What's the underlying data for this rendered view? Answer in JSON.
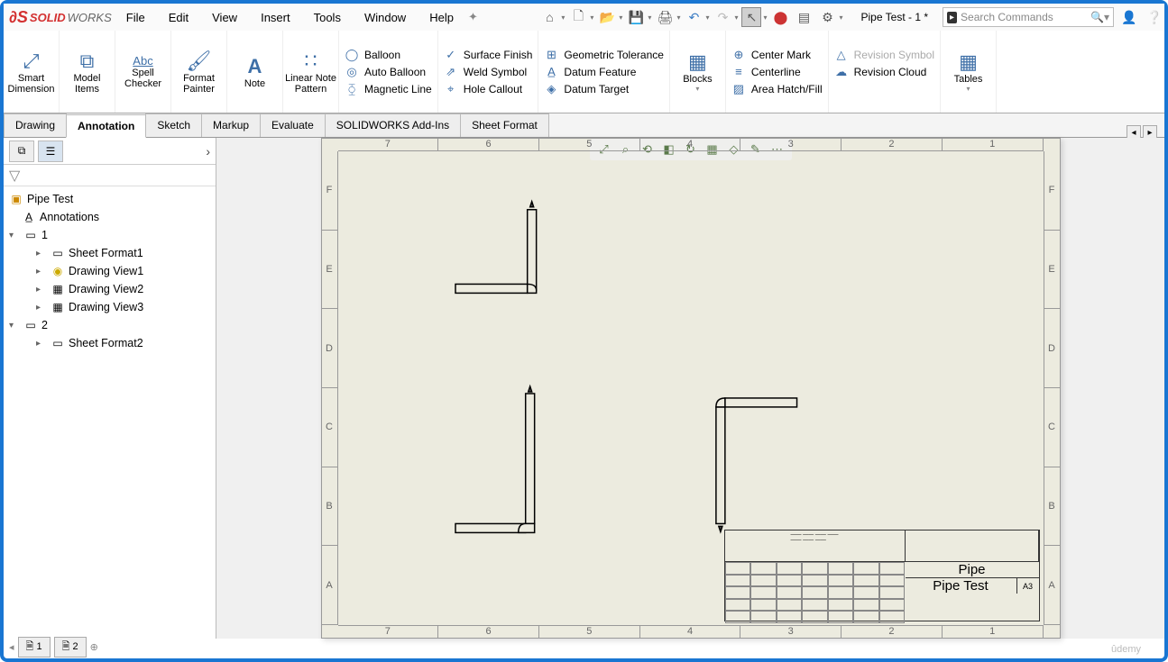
{
  "app": {
    "name_solid": "SOLID",
    "name_works": "WORKS"
  },
  "menu": [
    "File",
    "Edit",
    "View",
    "Insert",
    "Tools",
    "Window",
    "Help"
  ],
  "doc_title": "Pipe Test - 1 *",
  "search_placeholder": "Search Commands",
  "ribbon_big": [
    {
      "label": "Smart Dimension",
      "icon": "⤢"
    },
    {
      "label": "Model Items",
      "icon": "⧉"
    },
    {
      "label": "Spell Checker",
      "icon": "Abc"
    },
    {
      "label": "Format Painter",
      "icon": "🖌"
    },
    {
      "label": "Note",
      "icon": "A"
    },
    {
      "label": "Linear Note Pattern",
      "icon": "∷"
    }
  ],
  "ribbon_col1": [
    {
      "icon": "◯",
      "label": "Balloon"
    },
    {
      "icon": "◎",
      "label": "Auto Balloon"
    },
    {
      "icon": "⧲",
      "label": "Magnetic Line"
    }
  ],
  "ribbon_col2": [
    {
      "icon": "✓",
      "label": "Surface Finish"
    },
    {
      "icon": "⇗",
      "label": "Weld Symbol"
    },
    {
      "icon": "⌖",
      "label": "Hole Callout"
    }
  ],
  "ribbon_col3": [
    {
      "icon": "⊞",
      "label": "Geometric Tolerance"
    },
    {
      "icon": "A̲",
      "label": "Datum Feature"
    },
    {
      "icon": "◈",
      "label": "Datum Target"
    }
  ],
  "ribbon_blocks": {
    "label": "Blocks",
    "icon": "▦"
  },
  "ribbon_col4": [
    {
      "icon": "⊕",
      "label": "Center Mark"
    },
    {
      "icon": "≡",
      "label": "Centerline"
    },
    {
      "icon": "▨",
      "label": "Area Hatch/Fill"
    }
  ],
  "ribbon_col5": [
    {
      "icon": "△",
      "label": "Revision Symbol",
      "disabled": true
    },
    {
      "icon": "☁",
      "label": "Revision Cloud"
    },
    {
      "icon": "",
      "label": ""
    }
  ],
  "ribbon_tables": {
    "label": "Tables",
    "icon": "▦"
  },
  "tabs": [
    "Drawing",
    "Annotation",
    "Sketch",
    "Markup",
    "Evaluate",
    "SOLIDWORKS Add-Ins",
    "Sheet Format"
  ],
  "active_tab": "Annotation",
  "tree": {
    "root": "Pipe Test",
    "annotations": "Annotations",
    "sheet1": "1",
    "sheet1_items": [
      "Sheet Format1",
      "Drawing View1",
      "Drawing View2",
      "Drawing View3"
    ],
    "sheet2": "2",
    "sheet2_items": [
      "Sheet Format2"
    ]
  },
  "rulers": {
    "top": [
      "7",
      "6",
      "5",
      "4",
      "3",
      "2",
      "1"
    ],
    "bottom": [
      "7",
      "6",
      "5",
      "4",
      "3",
      "2",
      "1"
    ],
    "left": [
      "F",
      "E",
      "D",
      "C",
      "B",
      "A"
    ],
    "right": [
      "F",
      "E",
      "D",
      "C",
      "B",
      "A"
    ]
  },
  "titleblock": {
    "title1": "Pipe",
    "title2": "Pipe Test",
    "size": "A3"
  },
  "sheet_tabs": [
    "1",
    "2"
  ]
}
